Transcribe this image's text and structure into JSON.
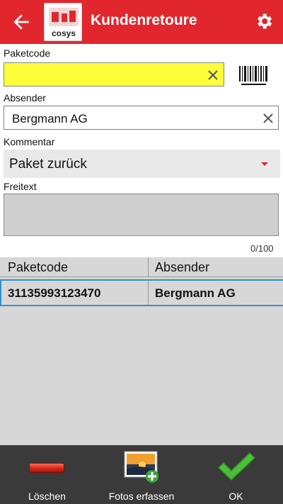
{
  "header": {
    "title": "Kundenretoure",
    "logo_text": "cosys"
  },
  "form": {
    "paketcode_label": "Paketcode",
    "paketcode_value": "",
    "absender_label": "Absender",
    "absender_value": "Bergmann AG",
    "kommentar_label": "Kommentar",
    "kommentar_value": "Paket zurück",
    "freitext_label": "Freitext",
    "freitext_value": "",
    "counter": "0/100"
  },
  "table": {
    "columns": [
      "Paketcode",
      "Absender"
    ],
    "rows": [
      {
        "paketcode": "31135993123470",
        "absender": "Bergmann AG"
      }
    ]
  },
  "bottombar": {
    "delete_label": "Löschen",
    "photos_label": "Fotos erfassen",
    "ok_label": "OK"
  },
  "colors": {
    "accent": "#e1272d",
    "paketcode_bg": "#fefe3a",
    "selection": "#2c93d1",
    "bottombar": "#3a3a3a"
  }
}
